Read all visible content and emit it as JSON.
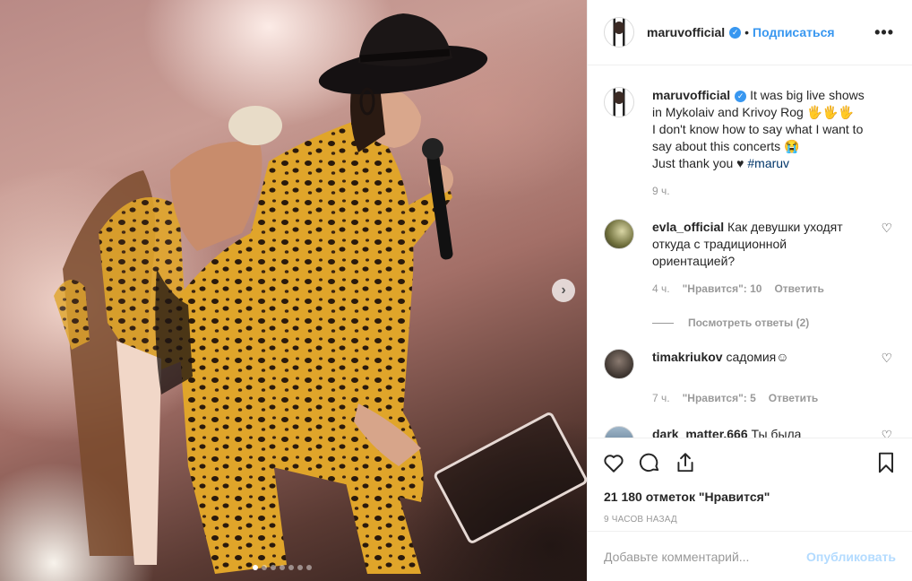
{
  "post": {
    "author": "maruvofficial",
    "verified_icon": "verified-check-icon",
    "separator": "•",
    "follow_label": "Подписаться",
    "more_label": "•••"
  },
  "media": {
    "next_label": "›",
    "dots_total": 7,
    "dots_active_index": 0
  },
  "caption": {
    "username": "maruvofficial",
    "line1": "It was big live shows",
    "line2": "in Mykolaiv and Krivoy Rog 🖐🖐🖐",
    "line3": "I don't know how to say what I want to",
    "line4": "say about this concerts 😭",
    "line5": "Just thank you ♥",
    "hashtag": "#maruv",
    "time": "9 ч."
  },
  "comments": [
    {
      "username": "evla_official",
      "text": "Как девушки уходят откуда с традиционной ориентацией?",
      "time": "4 ч.",
      "likes": "\"Нравится\": 10",
      "reply": "Ответить",
      "view_replies": "Посмотреть ответы (2)"
    },
    {
      "username": "timakriukov",
      "text": "садомия☺",
      "time": "7 ч.",
      "likes": "\"Нравится\": 5",
      "reply": "Ответить"
    },
    {
      "username": "dark_matter.666",
      "text": "Ты была"
    }
  ],
  "footer": {
    "likes_count": "21 180 отметок \"Нравится\"",
    "timestamp": "9 ЧАСОВ НАЗАД",
    "comment_placeholder": "Добавьте комментарий...",
    "publish_label": "Опубликовать"
  },
  "colors": {
    "accent": "#3897f0",
    "publish_disabled": "#b3dbff",
    "muted": "#999999",
    "border": "#efefef"
  }
}
